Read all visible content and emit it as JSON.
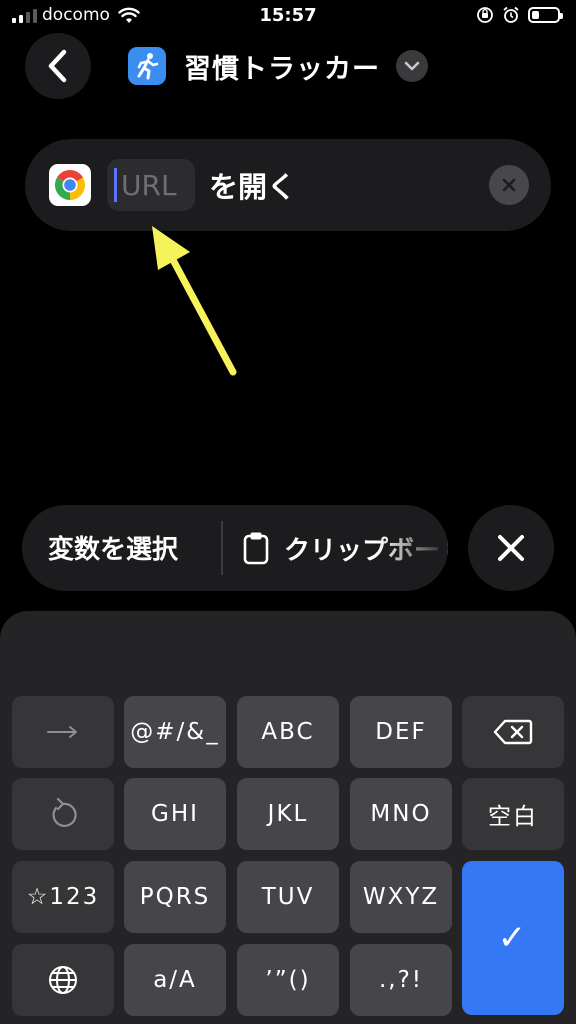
{
  "status_bar": {
    "carrier": "docomo",
    "time": "15:57",
    "signal_bars_filled": 2,
    "signal_bars_total": 4,
    "battery_level": 0.3
  },
  "header": {
    "back_icon": "chevron-left-icon",
    "app_icon": "running-person-icon",
    "title": "習慣トラッカー",
    "menu_icon": "chevron-down-icon"
  },
  "action": {
    "app_icon": "chrome-icon",
    "url_placeholder": "URL",
    "action_text": "を開く",
    "clear_icon": "clear-x-icon"
  },
  "toolbar": {
    "select_variable": "変数を選択",
    "clipboard_icon": "clipboard-icon",
    "clipboard_label": "クリップボード",
    "dismiss_icon": "close-icon"
  },
  "keyboard": {
    "keys": [
      {
        "label": "→",
        "icon": "arrow-right-icon"
      },
      {
        "label": "@#/&_"
      },
      {
        "label": "ABC"
      },
      {
        "label": "DEF"
      },
      {
        "label": "",
        "icon": "delete-icon"
      },
      {
        "label": "",
        "icon": "undo-icon"
      },
      {
        "label": "GHI"
      },
      {
        "label": "JKL"
      },
      {
        "label": "MNO"
      },
      {
        "label": "空白"
      },
      {
        "label": "☆123"
      },
      {
        "label": "PQRS"
      },
      {
        "label": "TUV"
      },
      {
        "label": "WXYZ"
      },
      {
        "label": "",
        "icon": "globe-icon"
      },
      {
        "label": "a/A"
      },
      {
        "label": "’”()"
      },
      {
        "label": ".,?!"
      },
      {
        "label": "✓",
        "icon": "checkmark-icon"
      }
    ]
  },
  "colors": {
    "background": "#000000",
    "surface": "#1c1c1e",
    "key": "#46464a",
    "key_function": "#363638",
    "accent": "#3478f6",
    "app_icon": "#3b8ef0",
    "annotation_arrow": "#f5f25a",
    "caret": "#5b74ff"
  }
}
